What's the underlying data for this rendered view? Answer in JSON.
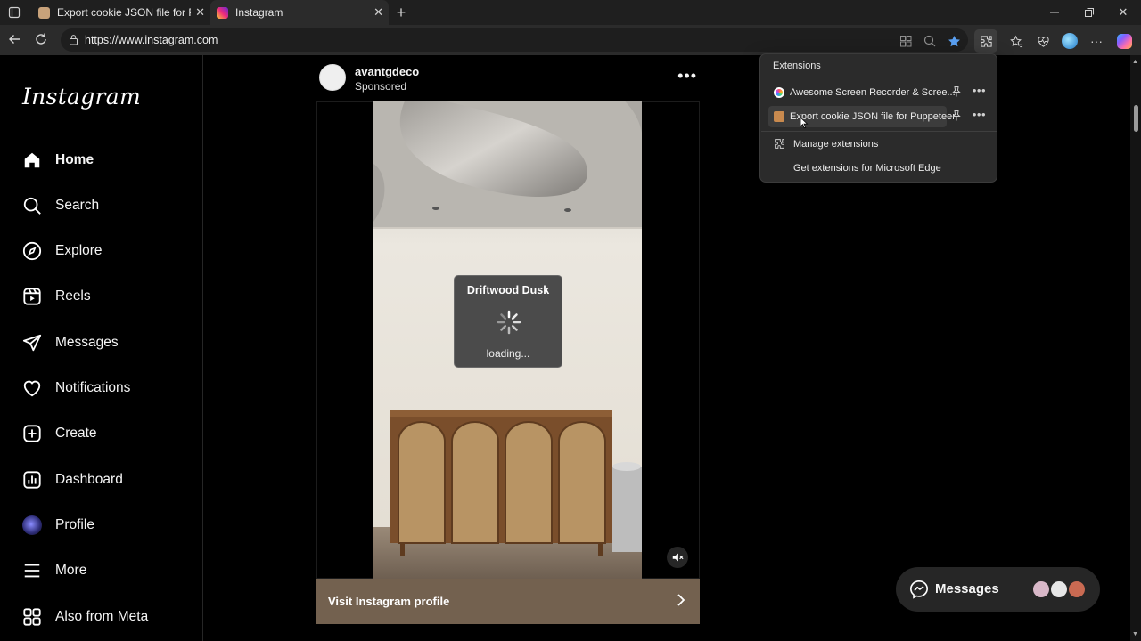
{
  "browser": {
    "tabs": [
      {
        "title": "Export cookie JSON file for Puppeteer",
        "active": false
      },
      {
        "title": "Instagram",
        "active": true
      }
    ],
    "url": "https://www.instagram.com"
  },
  "extensions_panel": {
    "header": "Extensions",
    "items": [
      {
        "name": "Awesome Screen Recorder & Scree..."
      },
      {
        "name": "Export cookie JSON file for Puppeteer"
      }
    ],
    "manage": "Manage extensions",
    "get": "Get extensions for Microsoft Edge"
  },
  "sidebar": {
    "logo": "Instagram",
    "items": [
      {
        "label": "Home",
        "icon": "home-icon"
      },
      {
        "label": "Search",
        "icon": "search-icon"
      },
      {
        "label": "Explore",
        "icon": "compass-icon"
      },
      {
        "label": "Reels",
        "icon": "reels-icon"
      },
      {
        "label": "Messages",
        "icon": "send-icon"
      },
      {
        "label": "Notifications",
        "icon": "heart-icon"
      },
      {
        "label": "Create",
        "icon": "plus-square-icon"
      },
      {
        "label": "Dashboard",
        "icon": "chart-icon"
      },
      {
        "label": "Profile",
        "icon": "avatar-icon"
      },
      {
        "label": "More",
        "icon": "menu-icon"
      },
      {
        "label": "Also from Meta",
        "icon": "grid-icon"
      }
    ]
  },
  "post": {
    "username": "avantgdeco",
    "sponsored": "Sponsored",
    "loader_title": "Driftwood Dusk",
    "loader_status": "loading...",
    "cta": "Visit Instagram profile"
  },
  "messages_pill": {
    "label": "Messages"
  },
  "colors": {
    "accent_cta": "#73614f",
    "background": "#000000",
    "panel": "#2b2b2b"
  }
}
